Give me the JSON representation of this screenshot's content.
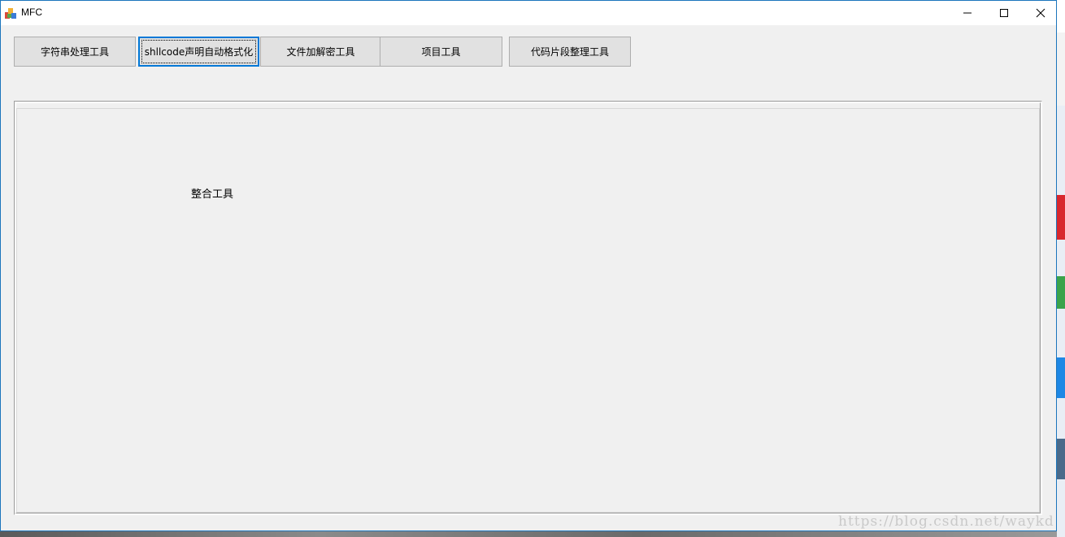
{
  "window": {
    "title": "MFC",
    "icon": "mfc-app-icon",
    "controls": {
      "minimize": "minimize-icon",
      "maximize": "maximize-icon",
      "close": "close-icon"
    }
  },
  "toolbar": {
    "buttons": [
      {
        "label": "字符串处理工具",
        "focused": false
      },
      {
        "label": "shllcode声明自动格式化",
        "focused": true
      },
      {
        "label": "文件加解密工具",
        "focused": false
      },
      {
        "label": "项目工具",
        "focused": false
      },
      {
        "label": "代码片段整理工具",
        "focused": false
      }
    ]
  },
  "panel": {
    "label": "整合工具"
  },
  "watermark": {
    "text": "https://blog.csdn.net/waykd"
  },
  "colors": {
    "window_border": "#1b75bc",
    "window_bg": "#f0f0f0",
    "button_bg": "#e1e1e1",
    "focus_border": "#0078d7"
  }
}
